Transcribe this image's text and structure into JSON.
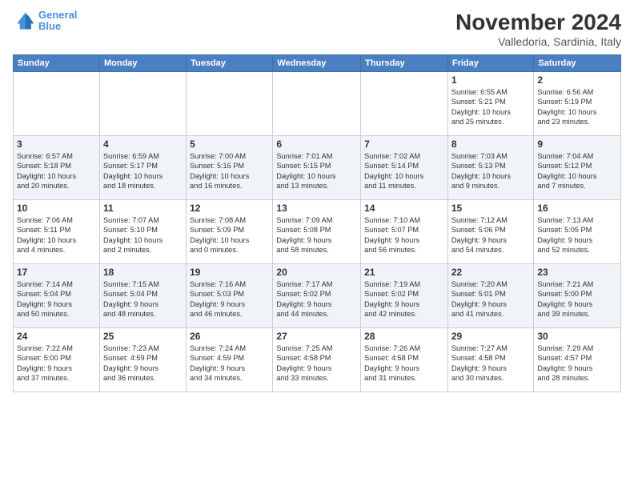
{
  "logo": {
    "line1": "General",
    "line2": "Blue"
  },
  "title": "November 2024",
  "location": "Valledoria, Sardinia, Italy",
  "weekdays": [
    "Sunday",
    "Monday",
    "Tuesday",
    "Wednesday",
    "Thursday",
    "Friday",
    "Saturday"
  ],
  "weeks": [
    [
      {
        "day": "",
        "info": ""
      },
      {
        "day": "",
        "info": ""
      },
      {
        "day": "",
        "info": ""
      },
      {
        "day": "",
        "info": ""
      },
      {
        "day": "",
        "info": ""
      },
      {
        "day": "1",
        "info": "Sunrise: 6:55 AM\nSunset: 5:21 PM\nDaylight: 10 hours\nand 25 minutes."
      },
      {
        "day": "2",
        "info": "Sunrise: 6:56 AM\nSunset: 5:19 PM\nDaylight: 10 hours\nand 23 minutes."
      }
    ],
    [
      {
        "day": "3",
        "info": "Sunrise: 6:57 AM\nSunset: 5:18 PM\nDaylight: 10 hours\nand 20 minutes."
      },
      {
        "day": "4",
        "info": "Sunrise: 6:59 AM\nSunset: 5:17 PM\nDaylight: 10 hours\nand 18 minutes."
      },
      {
        "day": "5",
        "info": "Sunrise: 7:00 AM\nSunset: 5:16 PM\nDaylight: 10 hours\nand 16 minutes."
      },
      {
        "day": "6",
        "info": "Sunrise: 7:01 AM\nSunset: 5:15 PM\nDaylight: 10 hours\nand 13 minutes."
      },
      {
        "day": "7",
        "info": "Sunrise: 7:02 AM\nSunset: 5:14 PM\nDaylight: 10 hours\nand 11 minutes."
      },
      {
        "day": "8",
        "info": "Sunrise: 7:03 AM\nSunset: 5:13 PM\nDaylight: 10 hours\nand 9 minutes."
      },
      {
        "day": "9",
        "info": "Sunrise: 7:04 AM\nSunset: 5:12 PM\nDaylight: 10 hours\nand 7 minutes."
      }
    ],
    [
      {
        "day": "10",
        "info": "Sunrise: 7:06 AM\nSunset: 5:11 PM\nDaylight: 10 hours\nand 4 minutes."
      },
      {
        "day": "11",
        "info": "Sunrise: 7:07 AM\nSunset: 5:10 PM\nDaylight: 10 hours\nand 2 minutes."
      },
      {
        "day": "12",
        "info": "Sunrise: 7:08 AM\nSunset: 5:09 PM\nDaylight: 10 hours\nand 0 minutes."
      },
      {
        "day": "13",
        "info": "Sunrise: 7:09 AM\nSunset: 5:08 PM\nDaylight: 9 hours\nand 58 minutes."
      },
      {
        "day": "14",
        "info": "Sunrise: 7:10 AM\nSunset: 5:07 PM\nDaylight: 9 hours\nand 56 minutes."
      },
      {
        "day": "15",
        "info": "Sunrise: 7:12 AM\nSunset: 5:06 PM\nDaylight: 9 hours\nand 54 minutes."
      },
      {
        "day": "16",
        "info": "Sunrise: 7:13 AM\nSunset: 5:05 PM\nDaylight: 9 hours\nand 52 minutes."
      }
    ],
    [
      {
        "day": "17",
        "info": "Sunrise: 7:14 AM\nSunset: 5:04 PM\nDaylight: 9 hours\nand 50 minutes."
      },
      {
        "day": "18",
        "info": "Sunrise: 7:15 AM\nSunset: 5:04 PM\nDaylight: 9 hours\nand 48 minutes."
      },
      {
        "day": "19",
        "info": "Sunrise: 7:16 AM\nSunset: 5:03 PM\nDaylight: 9 hours\nand 46 minutes."
      },
      {
        "day": "20",
        "info": "Sunrise: 7:17 AM\nSunset: 5:02 PM\nDaylight: 9 hours\nand 44 minutes."
      },
      {
        "day": "21",
        "info": "Sunrise: 7:19 AM\nSunset: 5:02 PM\nDaylight: 9 hours\nand 42 minutes."
      },
      {
        "day": "22",
        "info": "Sunrise: 7:20 AM\nSunset: 5:01 PM\nDaylight: 9 hours\nand 41 minutes."
      },
      {
        "day": "23",
        "info": "Sunrise: 7:21 AM\nSunset: 5:00 PM\nDaylight: 9 hours\nand 39 minutes."
      }
    ],
    [
      {
        "day": "24",
        "info": "Sunrise: 7:22 AM\nSunset: 5:00 PM\nDaylight: 9 hours\nand 37 minutes."
      },
      {
        "day": "25",
        "info": "Sunrise: 7:23 AM\nSunset: 4:59 PM\nDaylight: 9 hours\nand 36 minutes."
      },
      {
        "day": "26",
        "info": "Sunrise: 7:24 AM\nSunset: 4:59 PM\nDaylight: 9 hours\nand 34 minutes."
      },
      {
        "day": "27",
        "info": "Sunrise: 7:25 AM\nSunset: 4:58 PM\nDaylight: 9 hours\nand 33 minutes."
      },
      {
        "day": "28",
        "info": "Sunrise: 7:26 AM\nSunset: 4:58 PM\nDaylight: 9 hours\nand 31 minutes."
      },
      {
        "day": "29",
        "info": "Sunrise: 7:27 AM\nSunset: 4:58 PM\nDaylight: 9 hours\nand 30 minutes."
      },
      {
        "day": "30",
        "info": "Sunrise: 7:29 AM\nSunset: 4:57 PM\nDaylight: 9 hours\nand 28 minutes."
      }
    ]
  ]
}
